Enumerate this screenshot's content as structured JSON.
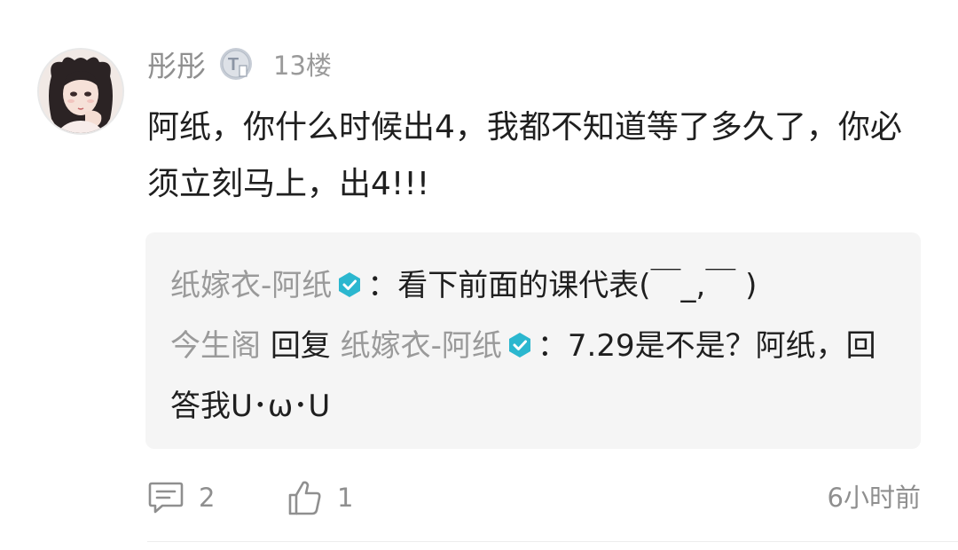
{
  "post": {
    "username": "彤彤",
    "level_badge_letter": "T",
    "floor": "13楼",
    "comment_text": "阿纸，你什么时候出4，我都不知道等了多久了，你必须立刻马上，出4!!!"
  },
  "replies": [
    {
      "author": "纸嫁衣-阿纸",
      "author_verified": true,
      "separator": "：",
      "text": "看下前面的课代表(￣_,￣ )"
    },
    {
      "author": "今生阁",
      "reply_word": "回复",
      "reply_to": "纸嫁衣-阿纸",
      "reply_to_verified": true,
      "separator": "：",
      "text": "7.29是不是？阿纸，回答我U･ω･U"
    }
  ],
  "actions": {
    "comment_count": "2",
    "like_count": "1",
    "time_ago": "6小时前"
  },
  "colors": {
    "verified_badge": "#2bb7cf",
    "level_badge": "#aab3bf",
    "username": "#8f8f8f",
    "reply_background": "#f5f5f5"
  }
}
